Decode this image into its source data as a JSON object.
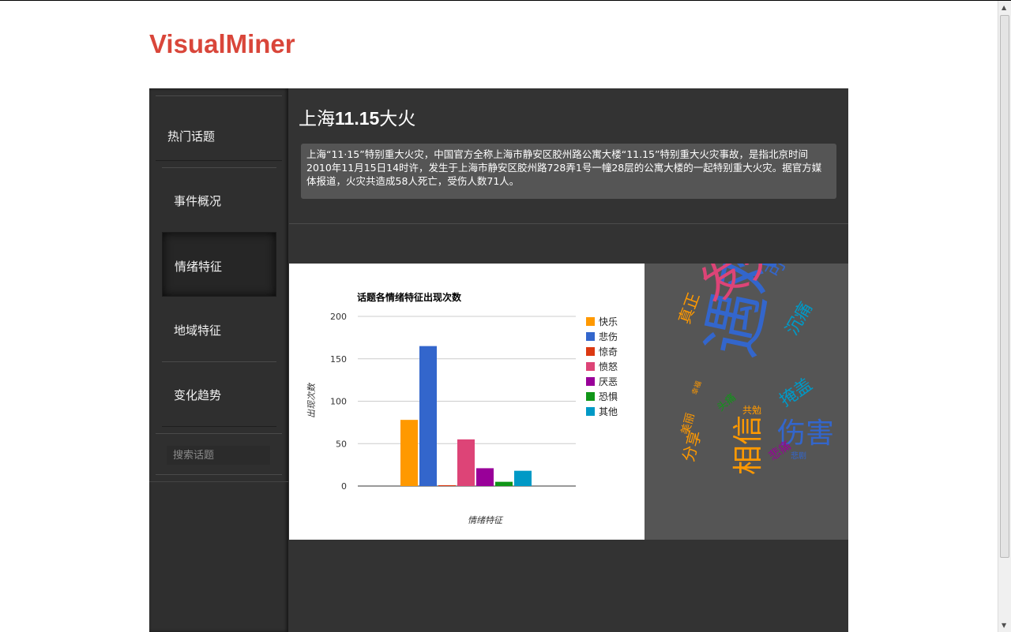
{
  "brand": "VisualMiner",
  "sidebar": {
    "items": [
      {
        "label": "热门话题"
      },
      {
        "label": "事件概况"
      },
      {
        "label": "情绪特征"
      },
      {
        "label": "地域特征"
      },
      {
        "label": "变化趋势"
      }
    ],
    "active_index": 2,
    "search_placeholder": "搜索话题"
  },
  "main": {
    "title_part1": "上海",
    "title_part2": "11.15",
    "title_part3": "大火",
    "description": "上海“11·15”特别重大火灾，中国官方全称上海市静安区胶州路公寓大楼“11.15”特别重大火灾事故，是指北京时间2010年11月15日14时许，发生于上海市静安区胶州路728弄1号一幢28层的公寓大楼的一起特别重大火灾。据官方媒体报道，火灾共造成58人死亡，受伤人数71人。"
  },
  "chart_data": {
    "type": "bar",
    "title": "话题各情绪特征出现次数",
    "xlabel": "情绪特征",
    "ylabel": "出现次数",
    "ylim": [
      0,
      200
    ],
    "yticks": [
      0,
      50,
      100,
      150,
      200
    ],
    "legend_position": "right",
    "series": [
      {
        "name": "快乐",
        "value": 78,
        "color": "#ff9900"
      },
      {
        "name": "悲伤",
        "value": 165,
        "color": "#3366cc"
      },
      {
        "name": "惊奇",
        "value": 1,
        "color": "#dc3912"
      },
      {
        "name": "愤怒",
        "value": 55,
        "color": "#dd4477"
      },
      {
        "name": "厌恶",
        "value": 21,
        "color": "#990099"
      },
      {
        "name": "恐惧",
        "value": 5,
        "color": "#109618"
      },
      {
        "name": "其他",
        "value": 18,
        "color": "#0099c6"
      }
    ]
  },
  "word_cloud": {
    "words": [
      {
        "text": "遇难",
        "color": "#3366cc"
      },
      {
        "text": "发火",
        "color": "#dd4477"
      },
      {
        "text": "伤害",
        "color": "#3366cc"
      },
      {
        "text": "相信",
        "color": "#ff9900"
      },
      {
        "text": "可怜",
        "color": "#3366cc"
      },
      {
        "text": "沉痛",
        "color": "#0099c6"
      },
      {
        "text": "掩盖",
        "color": "#0099c6"
      },
      {
        "text": "真正",
        "color": "#ff9900"
      },
      {
        "text": "分享",
        "color": "#ff9900"
      },
      {
        "text": "共勉",
        "color": "#ff9900"
      },
      {
        "text": "美丽",
        "color": "#ff9900"
      },
      {
        "text": "悲痛",
        "color": "#990099"
      },
      {
        "text": "头痛",
        "color": "#109618"
      },
      {
        "text": "悲剧",
        "color": "#3366cc"
      },
      {
        "text": "幸福",
        "color": "#ff9900"
      }
    ]
  }
}
